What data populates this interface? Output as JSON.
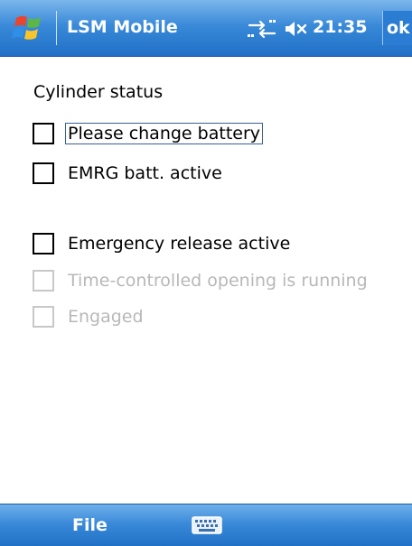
{
  "titlebar": {
    "app_title": "LSM Mobile",
    "clock": "21:35",
    "ok_label": "ok",
    "start_icon": "windows-start-icon",
    "connectivity_icon": "connectivity-icon",
    "volume_icon": "volume-muted-icon"
  },
  "content": {
    "section_label": "Cylinder status",
    "checkboxes": [
      {
        "label": "Please change battery",
        "checked": false,
        "enabled": true,
        "focused": true
      },
      {
        "label": "EMRG batt. active",
        "checked": false,
        "enabled": true,
        "focused": false
      },
      {
        "label": "Emergency release active",
        "checked": false,
        "enabled": true,
        "focused": false
      },
      {
        "label": "Time-controlled opening is running",
        "checked": false,
        "enabled": false,
        "focused": false
      },
      {
        "label": "Engaged",
        "checked": false,
        "enabled": false,
        "focused": false
      }
    ]
  },
  "menubar": {
    "file_label": "File",
    "keyboard_icon": "keyboard-icon"
  },
  "colors": {
    "bar_blue": "#3a8ad9",
    "disabled_gray": "#b8b8b8"
  }
}
